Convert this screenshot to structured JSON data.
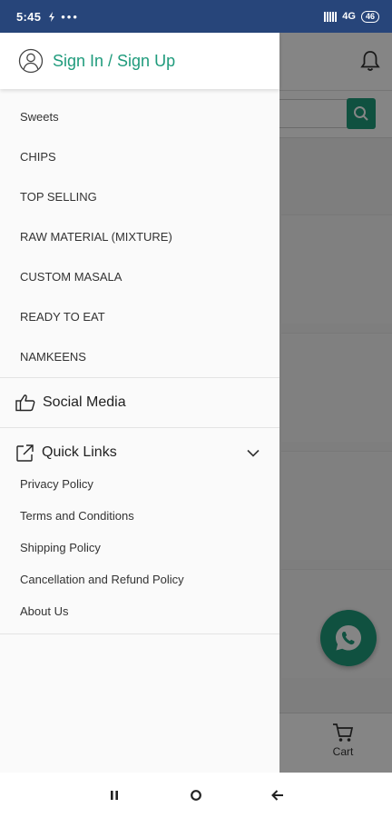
{
  "status_bar": {
    "time": "5:45",
    "network": "4G",
    "battery": "46"
  },
  "drawer": {
    "sign_in_label": "Sign In / Sign Up",
    "categories": [
      "Sweets",
      "CHIPS",
      "TOP SELLING",
      "RAW MATERIAL (MIXTURE)",
      "CUSTOM MASALA",
      "READY TO EAT",
      "NAMKEENS"
    ],
    "social_media_label": "Social Media",
    "quick_links_label": "Quick Links",
    "quick_links": [
      "Privacy Policy",
      "Terms and Conditions",
      "Shipping Policy",
      "Cancellation and Refund Policy",
      "About Us"
    ]
  },
  "background": {
    "cart_label": "Cart"
  },
  "colors": {
    "accent": "#1f9b7c",
    "status_bar": "#27457a"
  },
  "icons": [
    "user-icon",
    "thumbs-up-icon",
    "external-link-icon",
    "chevron-down-icon",
    "bell-icon",
    "search-icon",
    "cart-icon",
    "whatsapp-icon"
  ]
}
